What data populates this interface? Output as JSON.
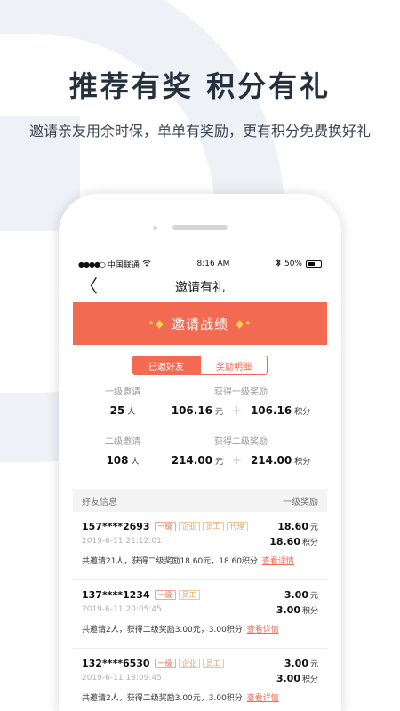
{
  "hero": {
    "headline": "推荐有奖  积分有礼",
    "subline": "邀请亲友用余时保，单单有奖励，更有积分免费换好礼"
  },
  "status_bar": {
    "carrier": "中国联通",
    "time": "8:16 AM",
    "battery": "50%"
  },
  "nav": {
    "back_glyph": "〈",
    "title": "邀请有礼"
  },
  "banner": {
    "title": "邀请战绩"
  },
  "tabs": [
    {
      "label": "已邀好友",
      "active": true
    },
    {
      "label": "奖励明细",
      "active": false
    }
  ],
  "stats": {
    "level1": {
      "invite_label": "一级邀请",
      "invite_count": "25",
      "invite_unit": "人",
      "reward_label": "获得一级奖励",
      "reward_money": "106.16",
      "money_unit": "元",
      "reward_points": "106.16",
      "points_unit": "积分"
    },
    "level2": {
      "invite_label": "二级邀请",
      "invite_count": "108",
      "invite_unit": "人",
      "reward_label": "获得二级奖励",
      "reward_money": "214.00",
      "money_unit": "元",
      "reward_points": "214.00",
      "points_unit": "积分"
    }
  },
  "friends_header": {
    "left": "好友信息",
    "right": "一级奖励"
  },
  "friends": [
    {
      "phone": "157****2693",
      "tags": [
        "一级",
        "企业",
        "员工",
        "代理"
      ],
      "money": "18.60",
      "money_unit": "元",
      "datetime": "2019-6-11  21:12:01",
      "points": "18.60",
      "points_unit": "积分",
      "summary": "共邀请21人，获得二级奖励18.60元，18.60积分",
      "link": "查看详情"
    },
    {
      "phone": "137****1234",
      "tags": [
        "一级",
        "员工"
      ],
      "money": "3.00",
      "money_unit": "元",
      "datetime": "2019-6-11  20:05:45",
      "points": "3.00",
      "points_unit": "积分",
      "summary": "共邀请2人，获得二级奖励3.00元，3.00积分",
      "link": "查看详情"
    },
    {
      "phone": "132****6530",
      "tags": [
        "一级",
        "企业",
        "员工"
      ],
      "money": "3.00",
      "money_unit": "元",
      "datetime": "2019-6-11  18:09:45",
      "points": "3.00",
      "points_unit": "积分",
      "summary": "共邀请2人，获得二级奖励3.00元，3.00积分",
      "link": "查看详情"
    }
  ],
  "colors": {
    "accent": "#f26a52",
    "tag_other": "#e8a25c",
    "heading": "#25303f"
  }
}
